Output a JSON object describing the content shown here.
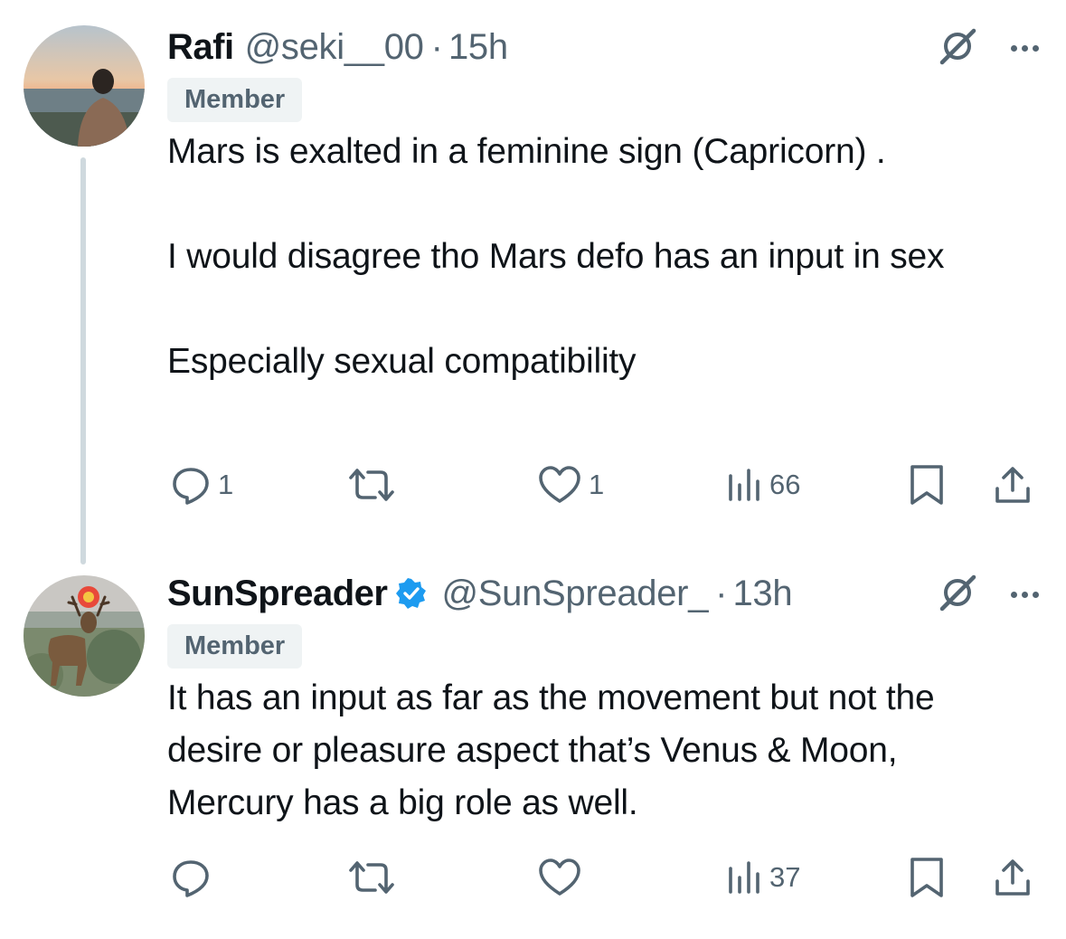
{
  "tweets": [
    {
      "name": "Rafi",
      "handle": "@seki__00",
      "separator": "·",
      "time": "15h",
      "badge": "Member",
      "paragraphs": [
        "Mars is exalted in a feminine sign (Capricorn) .",
        "I would disagree tho Mars defo has an input in sex",
        "Especially sexual compatibility"
      ],
      "replies": "1",
      "reposts": "",
      "likes": "1",
      "views": "66",
      "verified": false
    },
    {
      "name": "SunSpreader",
      "handle": "@SunSpreader_",
      "separator": "·",
      "time": "13h",
      "badge": "Member",
      "paragraphs": [
        "It has an input as far as the movement but not the desire or pleasure aspect that’s Venus & Moon, Mercury has a big role as well."
      ],
      "replies": "",
      "reposts": "",
      "likes": "",
      "views": "37",
      "verified": true
    }
  ],
  "icons": {
    "reply": "reply-icon",
    "repost": "repost-icon",
    "like": "like-icon",
    "views": "views-icon",
    "bookmark": "bookmark-icon",
    "share": "share-icon",
    "grok": "grok-icon",
    "more": "more-icon",
    "verified": "verified-badge-icon"
  },
  "colors": {
    "text": "#0f1419",
    "secondary": "#536471",
    "badge_bg": "#eff3f4",
    "verified": "#1d9bf0",
    "thread_line": "#cfd9de"
  }
}
